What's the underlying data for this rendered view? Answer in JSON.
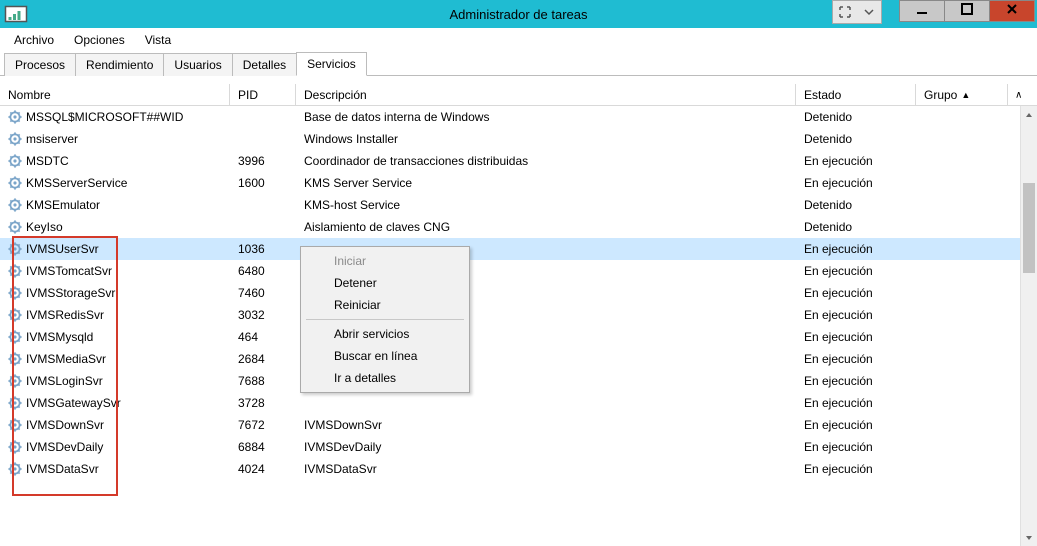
{
  "window": {
    "title": "Administrador de tareas"
  },
  "menu": {
    "file": "Archivo",
    "options": "Opciones",
    "view": "Vista"
  },
  "tabs": {
    "processes": "Procesos",
    "performance": "Rendimiento",
    "users": "Usuarios",
    "details": "Detalles",
    "services": "Servicios"
  },
  "columns": {
    "name": "Nombre",
    "pid": "PID",
    "desc": "Descripción",
    "state": "Estado",
    "group": "Grupo",
    "sort_indicator": "▲",
    "overflow": "⋀"
  },
  "context_menu": {
    "start": "Iniciar",
    "stop": "Detener",
    "restart": "Reiniciar",
    "open_services": "Abrir servicios",
    "search_online": "Buscar en línea",
    "go_to_details": "Ir a detalles"
  },
  "services": [
    {
      "name": "MSSQL$MICROSOFT##WID",
      "pid": "",
      "desc": "Base de datos interna de Windows",
      "state": "Detenido",
      "group": "",
      "selected": false
    },
    {
      "name": "msiserver",
      "pid": "",
      "desc": "Windows Installer",
      "state": "Detenido",
      "group": "",
      "selected": false
    },
    {
      "name": "MSDTC",
      "pid": "3996",
      "desc": "Coordinador de transacciones distribuidas",
      "state": "En ejecución",
      "group": "",
      "selected": false
    },
    {
      "name": "KMSServerService",
      "pid": "1600",
      "desc": "KMS Server Service",
      "state": "En ejecución",
      "group": "",
      "selected": false
    },
    {
      "name": "KMSEmulator",
      "pid": "",
      "desc": "KMS-host Service",
      "state": "Detenido",
      "group": "",
      "selected": false
    },
    {
      "name": "KeyIso",
      "pid": "",
      "desc": "Aislamiento de claves CNG",
      "state": "Detenido",
      "group": "",
      "selected": false
    },
    {
      "name": "IVMSUserSvr",
      "pid": "1036",
      "desc": "",
      "state": "En ejecución",
      "group": "",
      "selected": true
    },
    {
      "name": "IVMSTomcatSvr",
      "pid": "6480",
      "desc": "",
      "state": "En ejecución",
      "group": "",
      "selected": false
    },
    {
      "name": "IVMSStorageSvr",
      "pid": "7460",
      "desc": "",
      "state": "En ejecución",
      "group": "",
      "selected": false
    },
    {
      "name": "IVMSRedisSvr",
      "pid": "3032",
      "desc": "",
      "state": "En ejecución",
      "group": "",
      "selected": false
    },
    {
      "name": "IVMSMysqld",
      "pid": "464",
      "desc": "",
      "state": "En ejecución",
      "group": "",
      "selected": false
    },
    {
      "name": "IVMSMediaSvr",
      "pid": "2684",
      "desc": "",
      "state": "En ejecución",
      "group": "",
      "selected": false
    },
    {
      "name": "IVMSLoginSvr",
      "pid": "7688",
      "desc": "",
      "state": "En ejecución",
      "group": "",
      "selected": false
    },
    {
      "name": "IVMSGatewaySvr",
      "pid": "3728",
      "desc": "",
      "state": "En ejecución",
      "group": "",
      "selected": false
    },
    {
      "name": "IVMSDownSvr",
      "pid": "7672",
      "desc": "IVMSDownSvr",
      "state": "En ejecución",
      "group": "",
      "selected": false
    },
    {
      "name": "IVMSDevDaily",
      "pid": "6884",
      "desc": "IVMSDevDaily",
      "state": "En ejecución",
      "group": "",
      "selected": false
    },
    {
      "name": "IVMSDataSvr",
      "pid": "4024",
      "desc": "IVMSDataSvr",
      "state": "En ejecución",
      "group": "",
      "selected": false
    }
  ]
}
